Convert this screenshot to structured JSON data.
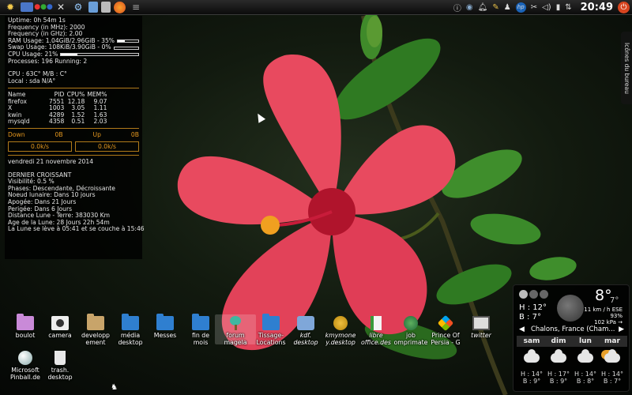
{
  "panel": {
    "launchers": [
      "menu-icon",
      "terminal-icon",
      "dots-icon",
      "tools-icon",
      "network-icon",
      "files-icon",
      "calculator-icon",
      "firefox-icon",
      "window-switcher-icon"
    ],
    "tray": [
      "info-icon",
      "updates-icon",
      "notify-icon",
      "clipboard-icon",
      "user-icon",
      "hp-icon",
      "scissors-icon",
      "volume-icon",
      "battery-icon",
      "network-icon"
    ],
    "hp_label": "hp",
    "clock": "20:49"
  },
  "conky": {
    "uptime": "Uptime: 0h 54m 1s",
    "freq_mhz": "Frequency (in MHz): 2000",
    "freq_ghz": "Frequency (in GHz): 2.00",
    "ram": "RAM Usage: 1.04GiB/2.96GiB - 35%",
    "ram_pct": 0.35,
    "swap": "Swap Usage: 108KiB/3.90GiB - 0%",
    "swap_pct": 0.0,
    "cpu": "CPU Usage: 21%",
    "cpu_pct": 0.21,
    "processes": "Processes: 196  Running: 2",
    "temps": "CPU : 63C° M/B : C°",
    "local": "Local   : sda N/A°",
    "proc_header": [
      "Name",
      "PID",
      "CPU%",
      "MEM%"
    ],
    "procs": [
      [
        "firefox",
        "7551",
        "12.18",
        "9.07"
      ],
      [
        "X",
        "1003",
        "3.05",
        "1.11"
      ],
      [
        "kwin",
        "4289",
        "1.52",
        "1.63"
      ],
      [
        "mysqld",
        "4358",
        "0.51",
        "2.03"
      ]
    ],
    "down_label": "Down",
    "down_val": "0B",
    "up_label": "Up",
    "up_val": "0B",
    "down_rate": "0.0k/s",
    "up_rate": "0.0k/s",
    "date": "vendredi 21 novembre 2014",
    "moon": [
      "DERNIER CROISSANT",
      "Visibilité: 0.5 %",
      "Phases: Descendante, Décroissante",
      "Noeud lunaire: Dans 10 jours",
      "Apogée: Dans 21 Jours",
      "Perigée: Dans 6 Jours",
      "Distance Lune - Terre: 383030 Km",
      "Age de la Lune: 28 Jours 22h 54m",
      "La Lune se lève à  05:41 et se couche à  15:46"
    ]
  },
  "desktop": {
    "icons": [
      {
        "label": "boulot",
        "kind": "folder-pink"
      },
      {
        "label": "camera",
        "kind": "camera-icon"
      },
      {
        "label": "developp\nement",
        "kind": "folder-tan"
      },
      {
        "label": "média\ndesktop",
        "kind": "folder"
      },
      {
        "label": "Messes",
        "kind": "folder"
      },
      {
        "label": "fin de\nmois",
        "kind": "folder"
      },
      {
        "label": "forum\nmagela",
        "kind": "tree-icon"
      },
      {
        "label": "Tissage-\nLocations",
        "kind": "folder"
      },
      {
        "label": "kdf.\ndesktop",
        "kind": "disk-icon"
      },
      {
        "label": "kmymone\ny.desktop",
        "kind": "money-icon"
      },
      {
        "label": "libre\noffice.des",
        "kind": "document-icon"
      },
      {
        "label": "job\nomprimate",
        "kind": "globe-icon"
      },
      {
        "label": "Prince Of\nPersia - G",
        "kind": "windows-icon"
      },
      {
        "label": "twitter",
        "kind": "screen-icon"
      },
      {
        "label": "Microsoft\nPinball.de",
        "kind": "pinball-icon"
      },
      {
        "label": "trash.\ndesktop",
        "kind": "trash-icon"
      }
    ]
  },
  "sidebar": {
    "label": "Icônes du bureau"
  },
  "weather": {
    "temp_now": "8°",
    "temp_unit_sub": "7°",
    "high": "H : 12°",
    "low": "B : 7°",
    "wind": "11 km / h ESE",
    "humidity": "93%",
    "pressure": "102 kPa →",
    "location": "Chalons, France (Cham...",
    "days": [
      "sam",
      "dim",
      "lun",
      "mar"
    ],
    "forecast": [
      {
        "h": "H : 14°",
        "b": "B : 9°"
      },
      {
        "h": "H : 17°",
        "b": "B : 9°"
      },
      {
        "h": "H : 14°",
        "b": "B : 8°"
      },
      {
        "h": "H : 14°",
        "b": "B : 7°"
      }
    ],
    "accent": "#e8a02a"
  }
}
